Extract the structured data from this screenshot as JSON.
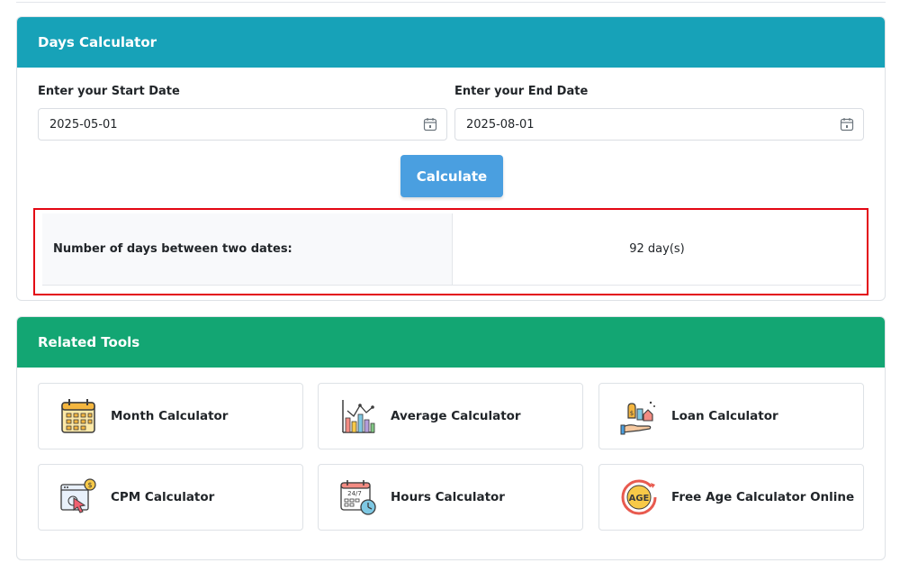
{
  "days_calculator": {
    "title": "Days Calculator",
    "start_label": "Enter your Start Date",
    "end_label": "Enter your End Date",
    "start_value": "2025-05-01",
    "end_value": "2025-08-01",
    "calculate_label": "Calculate",
    "result_label": "Number of days between two dates:",
    "result_value": "92 day(s)"
  },
  "related_tools": {
    "title": "Related Tools",
    "items": [
      {
        "label": "Month Calculator",
        "icon": "calendar-icon"
      },
      {
        "label": "Average Calculator",
        "icon": "bar-chart-icon"
      },
      {
        "label": "Loan Calculator",
        "icon": "money-hand-icon"
      },
      {
        "label": "CPM Calculator",
        "icon": "browser-cursor-icon"
      },
      {
        "label": "Hours Calculator",
        "icon": "calendar-clock-icon"
      },
      {
        "label": "Free Age Calculator Online",
        "icon": "age-icon"
      }
    ]
  },
  "colors": {
    "days_header": "#17a2b8",
    "tools_header": "#13a673",
    "button": "#4a9fe0",
    "highlight_border": "#e30613"
  }
}
